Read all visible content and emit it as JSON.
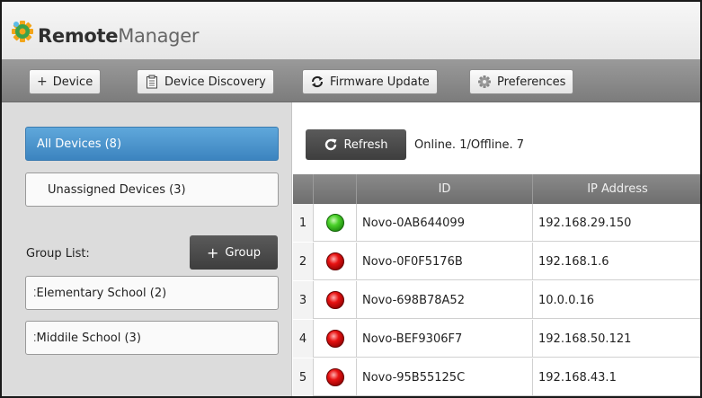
{
  "app": {
    "title_bold": "Remote",
    "title_light": "Manager"
  },
  "toolbar": {
    "add_device_label": "Device",
    "discovery_label": "Device Discovery",
    "firmware_label": "Firmware Update",
    "preferences_label": "Preferences"
  },
  "sidebar": {
    "all_devices_label": "All Devices (8)",
    "unassigned_label": "Unassigned Devices (3)",
    "group_list_label": "Group List:",
    "add_group_label": "Group",
    "groups": [
      {
        "label": "Elementary School (2)"
      },
      {
        "label": "Middile School (3)"
      }
    ]
  },
  "main": {
    "refresh_label": "Refresh",
    "status_text": "Online. 1/Offline. 7",
    "columns": {
      "id": "ID",
      "ip": "IP Address"
    },
    "rows": [
      {
        "num": "1",
        "status": "online",
        "id": "Novo-0AB644099",
        "ip": "192.168.29.150"
      },
      {
        "num": "2",
        "status": "offline",
        "id": "Novo-0F0F5176B",
        "ip": "192.168.1.6"
      },
      {
        "num": "3",
        "status": "offline",
        "id": "Novo-698B78A52",
        "ip": "10.0.0.16"
      },
      {
        "num": "4",
        "status": "offline",
        "id": "Novo-BEF9306F7",
        "ip": "192.168.50.121"
      },
      {
        "num": "5",
        "status": "offline",
        "id": "Novo-95B55125C",
        "ip": "192.168.43.1"
      }
    ]
  },
  "colors": {
    "accent_blue": "#3c84bf",
    "online_green": "#4bd12a",
    "offline_red": "#e81212"
  }
}
